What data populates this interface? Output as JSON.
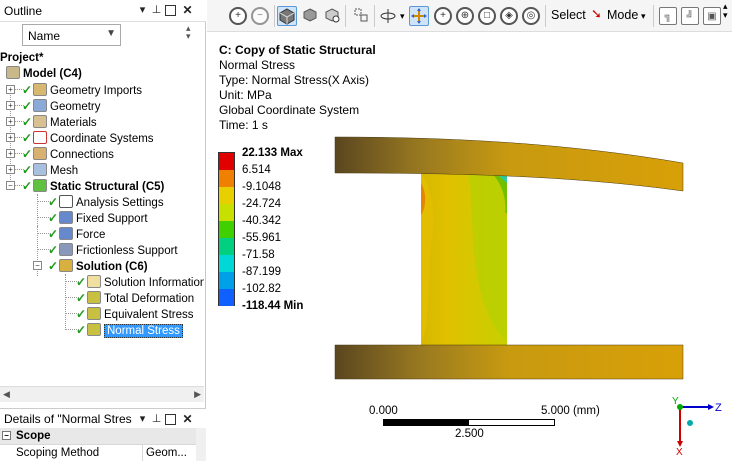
{
  "outline": {
    "title": "Outline",
    "filter_label": "Name",
    "tree": [
      {
        "label": "Project*",
        "bold": true
      },
      {
        "label": "Model (C4)",
        "bold": true
      },
      {
        "label": "Geometry Imports"
      },
      {
        "label": "Geometry"
      },
      {
        "label": "Materials"
      },
      {
        "label": "Coordinate Systems"
      },
      {
        "label": "Connections"
      },
      {
        "label": "Mesh"
      },
      {
        "label": "Static Structural (C5)",
        "bold": true
      },
      {
        "label": "Analysis Settings"
      },
      {
        "label": "Fixed Support"
      },
      {
        "label": "Force"
      },
      {
        "label": "Frictionless Support"
      },
      {
        "label": "Solution (C6)",
        "bold": true
      },
      {
        "label": "Solution Information"
      },
      {
        "label": "Total Deformation"
      },
      {
        "label": "Equivalent Stress"
      },
      {
        "label": "Normal Stress",
        "selected": true
      }
    ]
  },
  "details": {
    "title": "Details of \"Normal Stres",
    "section": "Scope",
    "row_label": "Scoping Method",
    "row_value": "Geom..."
  },
  "toolbar": {
    "select_label": "Select",
    "mode_label": "Mode"
  },
  "viewport": {
    "title": "C: Copy of Static Structural",
    "result": "Normal Stress",
    "type": "Type: Normal Stress(X Axis)",
    "unit": "Unit: MPa",
    "coords": "Global Coordinate System",
    "time": "Time: 1 s"
  },
  "legend": {
    "labels": [
      "22.133 Max",
      "6.514",
      "-9.1048",
      "-24.724",
      "-40.342",
      "-55.961",
      "-71.58",
      "-87.199",
      "-102.82",
      "-118.44 Min"
    ],
    "colors": [
      "#e00000",
      "#f08000",
      "#e8d000",
      "#c8e000",
      "#40d000",
      "#00d080",
      "#00d8d8",
      "#00a0e8",
      "#1060ff",
      "#0000e0"
    ]
  },
  "scale": {
    "left": "0.000",
    "right": "5.000 (mm)",
    "mid": "2.500"
  },
  "triad": {
    "y": "Y",
    "z": "Z",
    "x": "X"
  },
  "colors": {
    "selection": "#3399ff",
    "check": "#1a9a1a"
  }
}
